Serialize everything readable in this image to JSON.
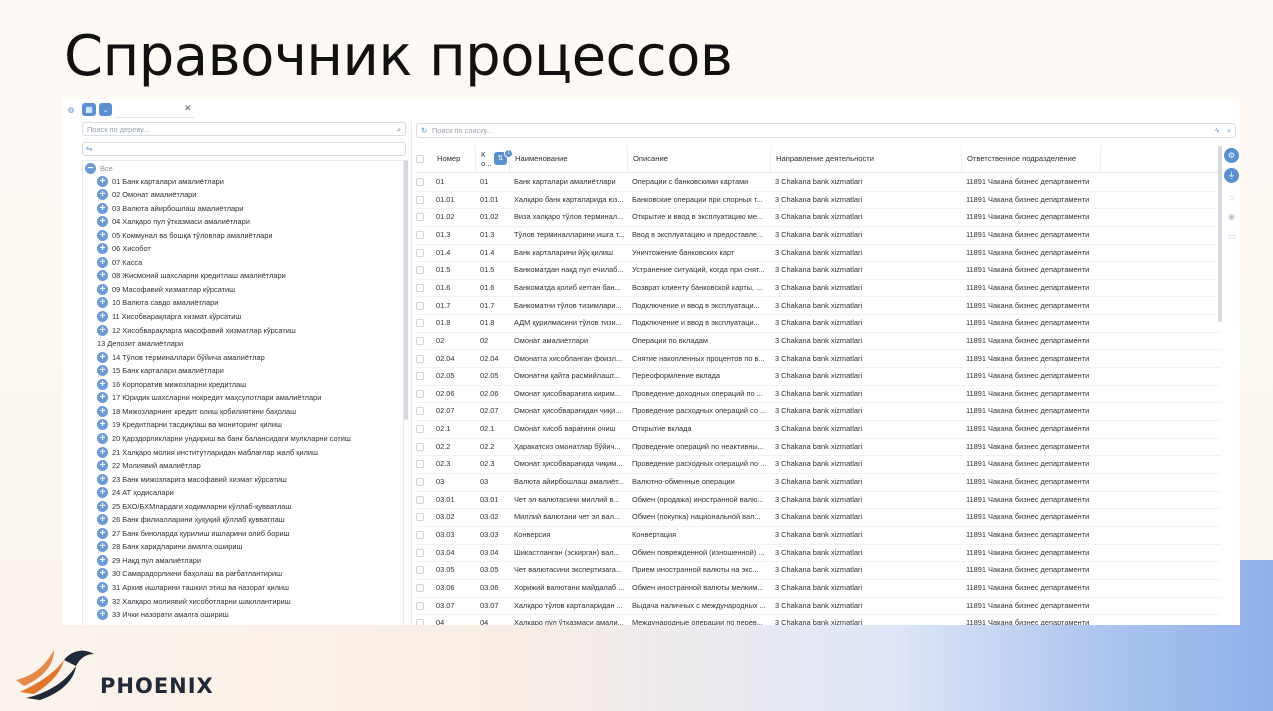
{
  "slide": {
    "title": "Справочник процессов"
  },
  "tree": {
    "search_placeholder": "Поиск по дереву...",
    "root_label": "Все",
    "items": [
      {
        "label": "01 Банк карталари амалиётлари",
        "expandable": true
      },
      {
        "label": "02 Омонат амалиётлари",
        "expandable": true
      },
      {
        "label": "03 Валюта айирбошлаш амалиётлари",
        "expandable": true
      },
      {
        "label": "04 Халқаро пул ўтказмаси амалиётлари",
        "expandable": true
      },
      {
        "label": "05 Коммунал ва бошқа тўловлар амалиётлари",
        "expandable": true
      },
      {
        "label": "06 Хисобот",
        "expandable": true
      },
      {
        "label": "07 Касса",
        "expandable": true
      },
      {
        "label": "08 Жисмоний шахсларни кредитлаш амалиётлари",
        "expandable": true
      },
      {
        "label": "09 Масофавий хизматлар кўрсатиш",
        "expandable": true
      },
      {
        "label": "10 Валюта савдо амалиётлари",
        "expandable": true
      },
      {
        "label": "11 Хисобварақларга хизмат кўрсатиш",
        "expandable": true
      },
      {
        "label": "12 Хисобварақларга масофавий хизматлар кўрсатиш",
        "expandable": true
      },
      {
        "label": "13 Депозит амалиётлари",
        "expandable": false
      },
      {
        "label": "14 Тўлов терминаллари бўйича амалиётлар",
        "expandable": true
      },
      {
        "label": "15 Банк карталари амалиётлари",
        "expandable": true
      },
      {
        "label": "16 Корпоратив мижозларни кредитлаш",
        "expandable": true
      },
      {
        "label": "17 Юридик шахсларни нокредит маҳсулотлари амалиётлари",
        "expandable": true
      },
      {
        "label": "18 Мижозларнинг кредит олиш қобилиятини баҳолаш",
        "expandable": true
      },
      {
        "label": "19 Кредитларни тасдиқлаш ва мониторинг қилиш",
        "expandable": true
      },
      {
        "label": "20 Қарздорликларни ундириш ва банк балансидаги мулкларни сотиш",
        "expandable": true
      },
      {
        "label": "21 Халқаро молия институтларидан маблағлар жалб қилиш",
        "expandable": true
      },
      {
        "label": "22 Молиявий амалиётлар",
        "expandable": true
      },
      {
        "label": "23 Банк мижозларига масофавий хизмат кўрсатиш",
        "expandable": true
      },
      {
        "label": "24 АТ ҳодисалари",
        "expandable": true
      },
      {
        "label": "25 БХО/БХМлардаги ходимларни кўллаб-қувватлаш",
        "expandable": true
      },
      {
        "label": "26 Банк филиалларини ҳуқуқий қўллаб қувватлаш",
        "expandable": true
      },
      {
        "label": "27 Банк бинолардa қурилиш ишларини олиб бориш",
        "expandable": true
      },
      {
        "label": "28 Банк харидларини амалга ошириш",
        "expandable": true
      },
      {
        "label": "29 Нақд пул амалиётлари",
        "expandable": true
      },
      {
        "label": "30 Самарадорликни баҳолаш ва рағбатлантириш",
        "expandable": true
      },
      {
        "label": "31 Архив ишларини ташкил этиш ва назорат қилиш",
        "expandable": true
      },
      {
        "label": "32 Халқаро молиявий хисоботларни шакллантириш",
        "expandable": true
      },
      {
        "label": "33 Ички назорати амалга ошириш",
        "expandable": true
      }
    ]
  },
  "list": {
    "search_placeholder": "Поиск по списку...",
    "columns": {
      "number": "Номер",
      "code": "К о...",
      "sort_badge": "1",
      "name": "Наименование",
      "description": "Описание",
      "direction": "Направление деятельности",
      "department": "Ответственное подразделение"
    },
    "rows": [
      {
        "number": "01",
        "code": "01",
        "name": "Банк карталари амалиётлари",
        "description": "Операции с банковскими картами",
        "direction": "3 Chakana bank xizmatlari",
        "department": "11891 Чакана бизнес департаменти"
      },
      {
        "number": "01.01",
        "code": "01.01",
        "name": "Халқаро банк карталарида юз...",
        "description": "Банковские операции при спорных т...",
        "direction": "3 Chakana bank xizmatlari",
        "department": "11891 Чакана бизнес департаменти"
      },
      {
        "number": "01.02",
        "code": "01.02",
        "name": "Виза халқаро тўлов терминал...",
        "description": "Открытие и ввод в эксплуатацию ме...",
        "direction": "3 Chakana bank xizmatlari",
        "department": "11891 Чакана бизнес департаменти"
      },
      {
        "number": "01.3",
        "code": "01.3",
        "name": "Тўлов терминалларини ишга т...",
        "description": "Ввод в эксплуатацию и предоставле...",
        "direction": "3 Chakana bank xizmatlari",
        "department": "11891 Чакана бизнес департаменти"
      },
      {
        "number": "01.4",
        "code": "01.4",
        "name": "Банк карталарини йўқ қилиш",
        "description": "Уничтожение банковских карт",
        "direction": "3 Chakana bank xizmatlari",
        "department": "11891 Чакана бизнес департаменти"
      },
      {
        "number": "01.5",
        "code": "01.5",
        "name": "Банкоматдан нақд пул ечилаб...",
        "description": "Устранение ситуаций, когда при снят...",
        "direction": "3 Chakana bank xizmatlari",
        "department": "11891 Чакана бизнес департаменти"
      },
      {
        "number": "01.6",
        "code": "01.6",
        "name": "Банкоматда қолиб кетган бан...",
        "description": "Возврат клиенту банковской карты, ...",
        "direction": "3 Chakana bank xizmatlari",
        "department": "11891 Чакана бизнес департаменти"
      },
      {
        "number": "01.7",
        "code": "01.7",
        "name": "Банкоматни тўлов тизимлари...",
        "description": "Подключение и ввод в эксплуатаци...",
        "direction": "3 Chakana bank xizmatlari",
        "department": "11891 Чакана бизнес департаменти"
      },
      {
        "number": "01.8",
        "code": "01.8",
        "name": "АДМ қурилмасини тўлов тизи...",
        "description": "Подключение и ввод в эксплуатаци...",
        "direction": "3 Chakana bank xizmatlari",
        "department": "11891 Чакана бизнес департаменти"
      },
      {
        "number": "02",
        "code": "02",
        "name": "Омонат амалиётлари",
        "description": "Операции по вкладам",
        "direction": "3 Chakana bank xizmatlari",
        "department": "11891 Чакана бизнес департаменти"
      },
      {
        "number": "02.04",
        "code": "02.04",
        "name": "Омонатга хисобланган фоизл...",
        "description": "Снятие накопленных процентов по в...",
        "direction": "3 Chakana bank xizmatlari",
        "department": "11891 Чакана бизнес департаменти"
      },
      {
        "number": "02.05",
        "code": "02.05",
        "name": "Омонатни қайта расмийлашт...",
        "description": "Переоформление вклада",
        "direction": "3 Chakana bank xizmatlari",
        "department": "11891 Чакана бизнес департаменти"
      },
      {
        "number": "02.06",
        "code": "02.06",
        "name": "Омонат ҳисобварағига кирим...",
        "description": "Проведение доходных операций по ...",
        "direction": "3 Chakana bank xizmatlari",
        "department": "11891 Чакана бизнес департаменти"
      },
      {
        "number": "02.07",
        "code": "02.07",
        "name": "Омонат ҳисобварағидан чиқи...",
        "description": "Проведение расходных операций со ...",
        "direction": "3 Chakana bank xizmatlari",
        "department": "11891 Чакана бизнес департаменти"
      },
      {
        "number": "02.1",
        "code": "02.1",
        "name": "Омонат хисоб варағини очиш",
        "description": "Открытие вклада",
        "direction": "3 Chakana bank xizmatlari",
        "department": "11891 Чакана бизнес департаменти"
      },
      {
        "number": "02.2",
        "code": "02.2",
        "name": "Ҳаракатсиз омонатлар бўйич...",
        "description": "Проведение операций по неактивны...",
        "direction": "3 Chakana bank xizmatlari",
        "department": "11891 Чакана бизнес департаменти"
      },
      {
        "number": "02.3",
        "code": "02.3",
        "name": "Омонат ҳисобварағида чиқим...",
        "description": "Проведение расходных операций по ...",
        "direction": "3 Chakana bank xizmatlari",
        "department": "11891 Чакана бизнес департаменти"
      },
      {
        "number": "03",
        "code": "03",
        "name": "Валюта айирбошлаш амалиёт...",
        "description": "Валютно-обменные операции",
        "direction": "3 Chakana bank xizmatlari",
        "department": "11891 Чакана бизнес департаменти"
      },
      {
        "number": "03.01",
        "code": "03.01",
        "name": "Чет эл валютасини миллий в...",
        "description": "Обмен (продажа) иностранной валю...",
        "direction": "3 Chakana bank xizmatlari",
        "department": "11891 Чакана бизнес департаменти"
      },
      {
        "number": "03.02",
        "code": "03.02",
        "name": "Миллий валютани чет эл вал...",
        "description": "Обмен (покупка) национальной вал...",
        "direction": "3 Chakana bank xizmatlari",
        "department": "11891 Чакана бизнес департаменти"
      },
      {
        "number": "03.03",
        "code": "03.03",
        "name": "Конверсия",
        "description": "Конвертация",
        "direction": "3 Chakana bank xizmatlari",
        "department": "11891 Чакана бизнес департаменти"
      },
      {
        "number": "03.04",
        "code": "03.04",
        "name": "Шикастланган (эскирган) вал...",
        "description": "Обмен поврежденной (изношенной) ...",
        "direction": "3 Chakana bank xizmatlari",
        "department": "11891 Чакана бизнес департаменти"
      },
      {
        "number": "03.05",
        "code": "03.05",
        "name": "Чет валютасини экспертизага...",
        "description": "Прием иностранной валюты на экс...",
        "direction": "3 Chakana bank xizmatlari",
        "department": "11891 Чакана бизнес департаменти"
      },
      {
        "number": "03.06",
        "code": "03.06",
        "name": "Хорижий валютани майдалаб ...",
        "description": "Обмен иностранной валюты мелким...",
        "direction": "3 Chakana bank xizmatlari",
        "department": "11891 Чакана бизнес департаменти"
      },
      {
        "number": "03.07",
        "code": "03.07",
        "name": "Халқаро тўлов карталаридан ...",
        "description": "Выдача наличных с международных ...",
        "direction": "3 Chakana bank xizmatlari",
        "department": "11891 Чакана бизнес департаменти"
      },
      {
        "number": "04",
        "code": "04",
        "name": "Халқаро пул ўтказмаси амали...",
        "description": "Международные операции по перев...",
        "direction": "3 Chakana bank xizmatlari",
        "department": "11891 Чакана бизнес департаменти"
      }
    ]
  },
  "brand": {
    "logo_text": "PHOENIX"
  },
  "colors": {
    "accent": "#5a8fd0",
    "logo_orange": "#e0762b"
  }
}
